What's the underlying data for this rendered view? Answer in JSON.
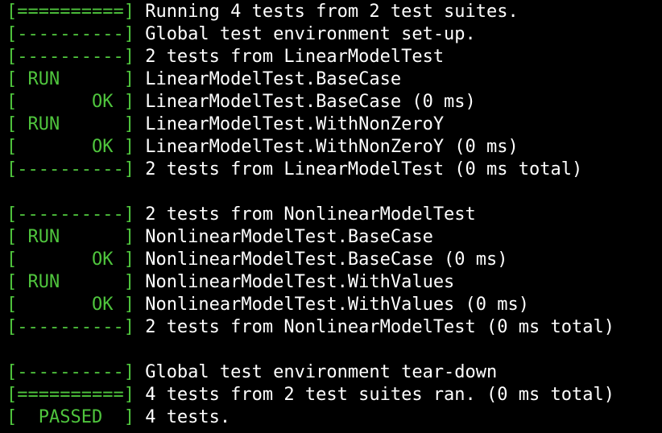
{
  "colors": {
    "background": "#000000",
    "tag_green": "#4fc53d",
    "text": "#ffffff"
  },
  "lines": [
    {
      "tag": "[==========]",
      "text": " Running 4 tests from 2 test suites."
    },
    {
      "tag": "[----------]",
      "text": " Global test environment set-up."
    },
    {
      "tag": "[----------]",
      "text": " 2 tests from LinearModelTest"
    },
    {
      "tag": "[ RUN      ]",
      "text": " LinearModelTest.BaseCase"
    },
    {
      "tag": "[       OK ]",
      "text": " LinearModelTest.BaseCase (0 ms)"
    },
    {
      "tag": "[ RUN      ]",
      "text": " LinearModelTest.WithNonZeroY"
    },
    {
      "tag": "[       OK ]",
      "text": " LinearModelTest.WithNonZeroY (0 ms)"
    },
    {
      "tag": "[----------]",
      "text": " 2 tests from LinearModelTest (0 ms total)"
    },
    {
      "tag": "",
      "text": ""
    },
    {
      "tag": "[----------]",
      "text": " 2 tests from NonlinearModelTest"
    },
    {
      "tag": "[ RUN      ]",
      "text": " NonlinearModelTest.BaseCase"
    },
    {
      "tag": "[       OK ]",
      "text": " NonlinearModelTest.BaseCase (0 ms)"
    },
    {
      "tag": "[ RUN      ]",
      "text": " NonlinearModelTest.WithValues"
    },
    {
      "tag": "[       OK ]",
      "text": " NonlinearModelTest.WithValues (0 ms)"
    },
    {
      "tag": "[----------]",
      "text": " 2 tests from NonlinearModelTest (0 ms total)"
    },
    {
      "tag": "",
      "text": ""
    },
    {
      "tag": "[----------]",
      "text": " Global test environment tear-down"
    },
    {
      "tag": "[==========]",
      "text": " 4 tests from 2 test suites ran. (0 ms total)"
    },
    {
      "tag": "[  PASSED  ]",
      "text": " 4 tests."
    }
  ]
}
